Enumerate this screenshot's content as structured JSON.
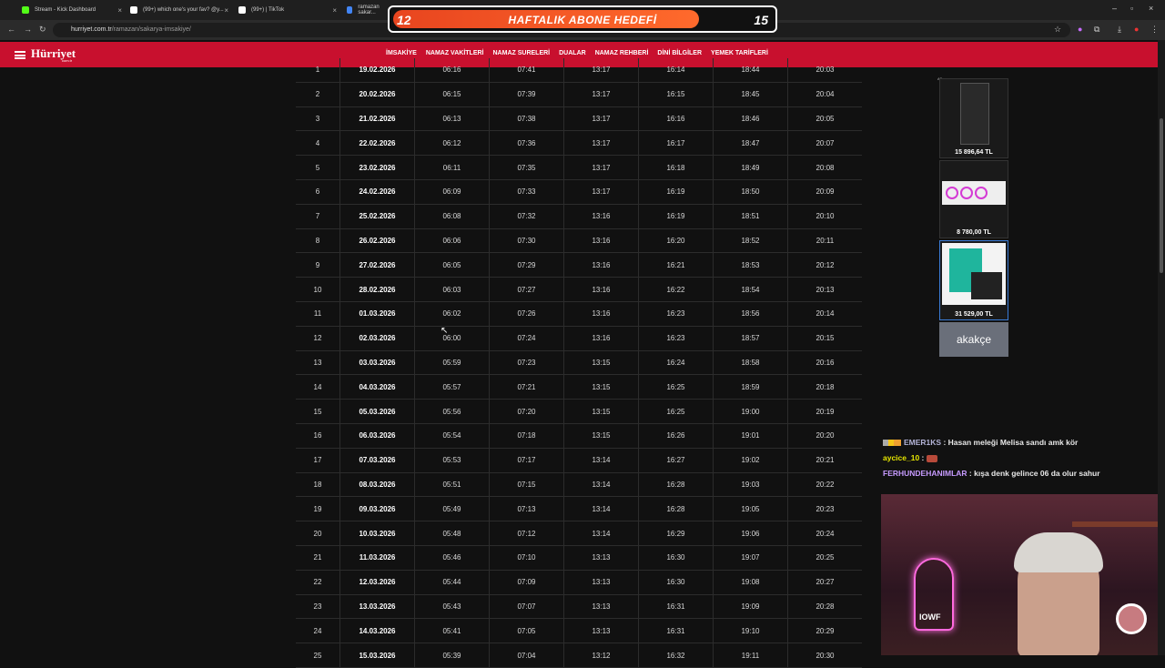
{
  "browser": {
    "tabs": [
      {
        "title": "Stream - Kick Dashboard",
        "color": "#53fc18"
      },
      {
        "title": "(99+) which one's your fav? @y...",
        "color": "#ffffff"
      },
      {
        "title": "(99+) | TikTok",
        "color": "#ffffff"
      },
      {
        "title": "ramazan sakar...",
        "color": "#4285f4"
      }
    ],
    "url_host": "hurriyet.com.tr",
    "url_path": "/ramazan/sakarya-imsakiye/"
  },
  "goal_banner": {
    "label": "HAFTALIK ABONE HEDEFİ",
    "current": "12",
    "target": "15"
  },
  "site": {
    "logo": "Hürriyet",
    "logo_sub": "com.tr",
    "menu": [
      "İMSAKİYE",
      "NAMAZ VAKİTLERİ",
      "NAMAZ SURELERİ",
      "DUALAR",
      "NAMAZ REHBERİ",
      "DİNİ BİLGİLER",
      "YEMEK TARİFLERİ"
    ]
  },
  "table": {
    "rows": [
      [
        "1",
        "19.02.2026",
        "06:16",
        "07:41",
        "13:17",
        "16:14",
        "18:44",
        "20:03"
      ],
      [
        "2",
        "20.02.2026",
        "06:15",
        "07:39",
        "13:17",
        "16:15",
        "18:45",
        "20:04"
      ],
      [
        "3",
        "21.02.2026",
        "06:13",
        "07:38",
        "13:17",
        "16:16",
        "18:46",
        "20:05"
      ],
      [
        "4",
        "22.02.2026",
        "06:12",
        "07:36",
        "13:17",
        "16:17",
        "18:47",
        "20:07"
      ],
      [
        "5",
        "23.02.2026",
        "06:11",
        "07:35",
        "13:17",
        "16:18",
        "18:49",
        "20:08"
      ],
      [
        "6",
        "24.02.2026",
        "06:09",
        "07:33",
        "13:17",
        "16:19",
        "18:50",
        "20:09"
      ],
      [
        "7",
        "25.02.2026",
        "06:08",
        "07:32",
        "13:16",
        "16:19",
        "18:51",
        "20:10"
      ],
      [
        "8",
        "26.02.2026",
        "06:06",
        "07:30",
        "13:16",
        "16:20",
        "18:52",
        "20:11"
      ],
      [
        "9",
        "27.02.2026",
        "06:05",
        "07:29",
        "13:16",
        "16:21",
        "18:53",
        "20:12"
      ],
      [
        "10",
        "28.02.2026",
        "06:03",
        "07:27",
        "13:16",
        "16:22",
        "18:54",
        "20:13"
      ],
      [
        "11",
        "01.03.2026",
        "06:02",
        "07:26",
        "13:16",
        "16:23",
        "18:56",
        "20:14"
      ],
      [
        "12",
        "02.03.2026",
        "06:00",
        "07:24",
        "13:16",
        "16:23",
        "18:57",
        "20:15"
      ],
      [
        "13",
        "03.03.2026",
        "05:59",
        "07:23",
        "13:15",
        "16:24",
        "18:58",
        "20:16"
      ],
      [
        "14",
        "04.03.2026",
        "05:57",
        "07:21",
        "13:15",
        "16:25",
        "18:59",
        "20:18"
      ],
      [
        "15",
        "05.03.2026",
        "05:56",
        "07:20",
        "13:15",
        "16:25",
        "19:00",
        "20:19"
      ],
      [
        "16",
        "06.03.2026",
        "05:54",
        "07:18",
        "13:15",
        "16:26",
        "19:01",
        "20:20"
      ],
      [
        "17",
        "07.03.2026",
        "05:53",
        "07:17",
        "13:14",
        "16:27",
        "19:02",
        "20:21"
      ],
      [
        "18",
        "08.03.2026",
        "05:51",
        "07:15",
        "13:14",
        "16:28",
        "19:03",
        "20:22"
      ],
      [
        "19",
        "09.03.2026",
        "05:49",
        "07:13",
        "13:14",
        "16:28",
        "19:05",
        "20:23"
      ],
      [
        "20",
        "10.03.2026",
        "05:48",
        "07:12",
        "13:14",
        "16:29",
        "19:06",
        "20:24"
      ],
      [
        "21",
        "11.03.2026",
        "05:46",
        "07:10",
        "13:13",
        "16:30",
        "19:07",
        "20:25"
      ],
      [
        "22",
        "12.03.2026",
        "05:44",
        "07:09",
        "13:13",
        "16:30",
        "19:08",
        "20:27"
      ],
      [
        "23",
        "13.03.2026",
        "05:43",
        "07:07",
        "13:13",
        "16:31",
        "19:09",
        "20:28"
      ],
      [
        "24",
        "14.03.2026",
        "05:41",
        "07:05",
        "13:13",
        "16:31",
        "19:10",
        "20:29"
      ],
      [
        "25",
        "15.03.2026",
        "05:39",
        "07:04",
        "13:12",
        "16:32",
        "19:11",
        "20:30"
      ]
    ]
  },
  "ads": {
    "tag": "AD",
    "items": [
      {
        "price": "15 896,64 TL"
      },
      {
        "price": "8 780,00 TL"
      },
      {
        "price": "31 529,00 TL"
      }
    ],
    "brand": "akakçe"
  },
  "chat": {
    "messages": [
      {
        "user": "EMER1KS",
        "text": "Hasan meleği Melisa sandı amk kör"
      },
      {
        "user": "aycice_10",
        "text": ""
      },
      {
        "user": "FERHUNDEHANIMLAR",
        "text": "kışa denk gelince 06 da olur sahur"
      }
    ]
  },
  "webcam": {
    "neon_text": "IOWF"
  }
}
